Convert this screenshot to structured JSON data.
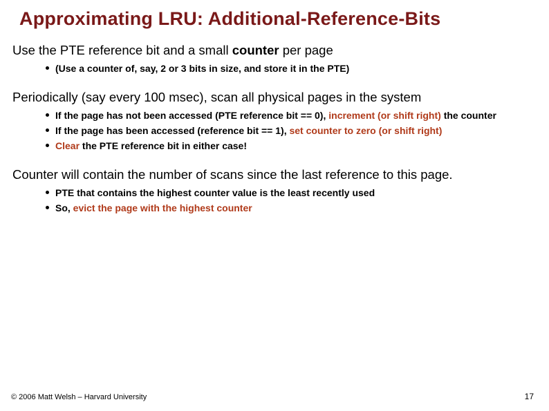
{
  "title": "Approximating LRU:   Additional-Reference-Bits",
  "section1": {
    "text_a": "Use the PTE reference bit and a small ",
    "text_b_bold": "counter",
    "text_c": " per page",
    "bullets": [
      {
        "text": "(Use a counter of, say, 2 or 3 bits in size, and store it in the PTE)"
      }
    ]
  },
  "section2": {
    "text": "Periodically (say every 100 msec), scan all physical pages in the system",
    "bullets": [
      {
        "pre": "If the page has not been accessed (PTE reference bit == 0), ",
        "accent": "increment (or shift right)",
        "post": " the counter"
      },
      {
        "pre": "If the page has been accessed (reference bit == 1), ",
        "accent": "set counter to zero (or shift right)",
        "post": ""
      },
      {
        "pre": "",
        "accent": "Clear",
        "post": " the PTE reference bit in either case!"
      }
    ]
  },
  "section3": {
    "text": "Counter will contain the number of scans since the last reference to this page.",
    "bullets": [
      {
        "text": "PTE that contains the highest counter value is the least recently used"
      },
      {
        "pre": "So, ",
        "accent": "evict the page with the highest counter",
        "post": ""
      }
    ]
  },
  "footer": "© 2006 Matt Welsh – Harvard University",
  "page_number": "17"
}
